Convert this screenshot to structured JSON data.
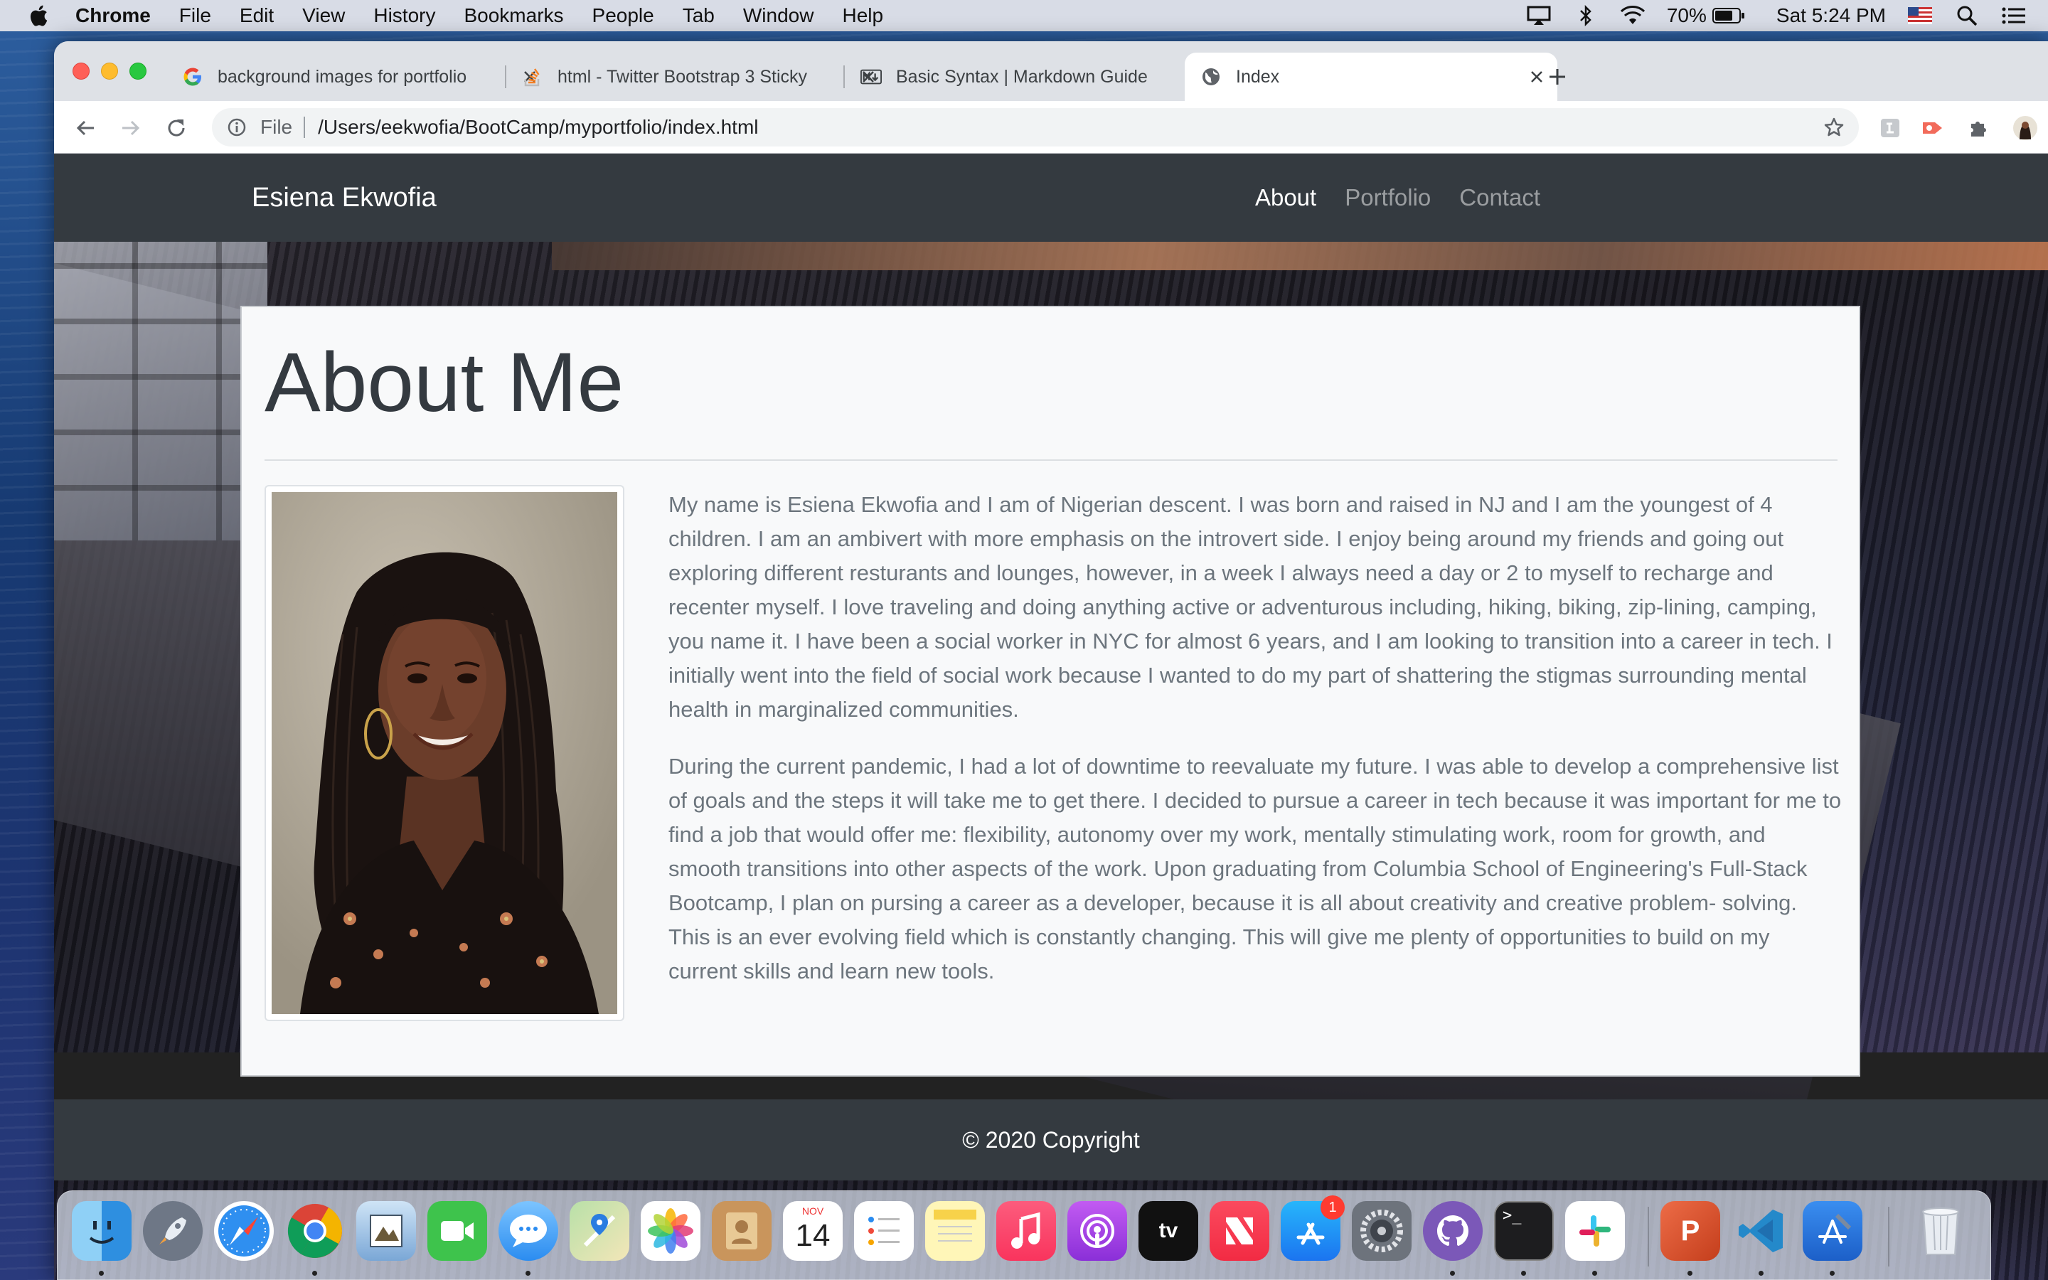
{
  "menubar": {
    "app_name": "Chrome",
    "items": [
      "File",
      "Edit",
      "View",
      "History",
      "Bookmarks",
      "People",
      "Tab",
      "Window",
      "Help"
    ],
    "battery": "70%",
    "clock": "Sat 5:24 PM"
  },
  "browser": {
    "tabs": [
      {
        "title": "background images for portfolio",
        "favicon": "google-icon"
      },
      {
        "title": "html - Twitter Bootstrap 3 Sticky",
        "favicon": "stackoverflow-icon"
      },
      {
        "title": "Basic Syntax | Markdown Guide",
        "favicon": "markdown-icon"
      },
      {
        "title": "Index",
        "favicon": "globe-icon",
        "active": true
      }
    ],
    "omnibox": {
      "scheme": "File",
      "url": "/Users/eekwofia/BootCamp/myportfolio/index.html"
    }
  },
  "page": {
    "brand": "Esiena Ekwofia",
    "nav": [
      {
        "label": "About",
        "active": true
      },
      {
        "label": "Portfolio",
        "active": false
      },
      {
        "label": "Contact",
        "active": false
      }
    ],
    "heading": "About Me",
    "paragraphs": [
      "My name is Esiena Ekwofia and I am of Nigerian descent. I was born and raised in NJ and I am the youngest of 4 children. I am an ambivert with more emphasis on the introvert side. I enjoy being around my friends and going out exploring different resturants and lounges, however, in a week I always need a day or 2 to myself to recharge and recenter myself. I love traveling and doing anything active or adventurous including, hiking, biking, zip-lining, camping, you name it. I have been a social worker in NYC for almost 6 years, and I am looking to transition into a career in tech. I initially went into the field of social work because I wanted to do my part of shattering the stigmas surrounding mental health in marginalized communities.",
      "During the current pandemic, I had a lot of downtime to reevaluate my future. I was able to develop a comprehensive list of goals and the steps it will take me to get there. I decided to pursue a career in tech because it was important for me to find a job that would offer me: flexibility, autonomy over my work, mentally stimulating work, room for growth, and smooth transitions into other aspects of the work. Upon graduating from Columbia School of Engineering's Full-Stack Bootcamp, I plan on pursing a career as a developer, because it is all about creativity and creative problem- solving. This is an ever evolving field which is constantly changing. This will give me plenty of opportunities to build on my current skills and learn new tools."
    ],
    "footer": "© 2020 Copyright"
  },
  "dock": {
    "calendar_month": "NOV",
    "calendar_day": "14",
    "appstore_badge": "1",
    "apps": [
      "finder-icon",
      "launchpad-icon",
      "safari-icon",
      "chrome-icon",
      "preview-icon",
      "facetime-icon",
      "messages-icon",
      "maps-icon",
      "photos-icon",
      "contacts-icon",
      "calendar-icon",
      "reminders-icon",
      "notes-icon",
      "music-icon",
      "podcasts-icon",
      "tv-icon",
      "news-icon",
      "appstore-icon",
      "system-preferences-icon",
      "github-icon",
      "terminal-icon",
      "slack-icon",
      "powerpoint-icon",
      "vscode-icon",
      "xcode-icon",
      "trash-icon"
    ]
  },
  "colors": {
    "navbar": "#343a40",
    "card": "#f8f9fa",
    "text_muted": "#6c757d",
    "heading": "#343a40"
  }
}
